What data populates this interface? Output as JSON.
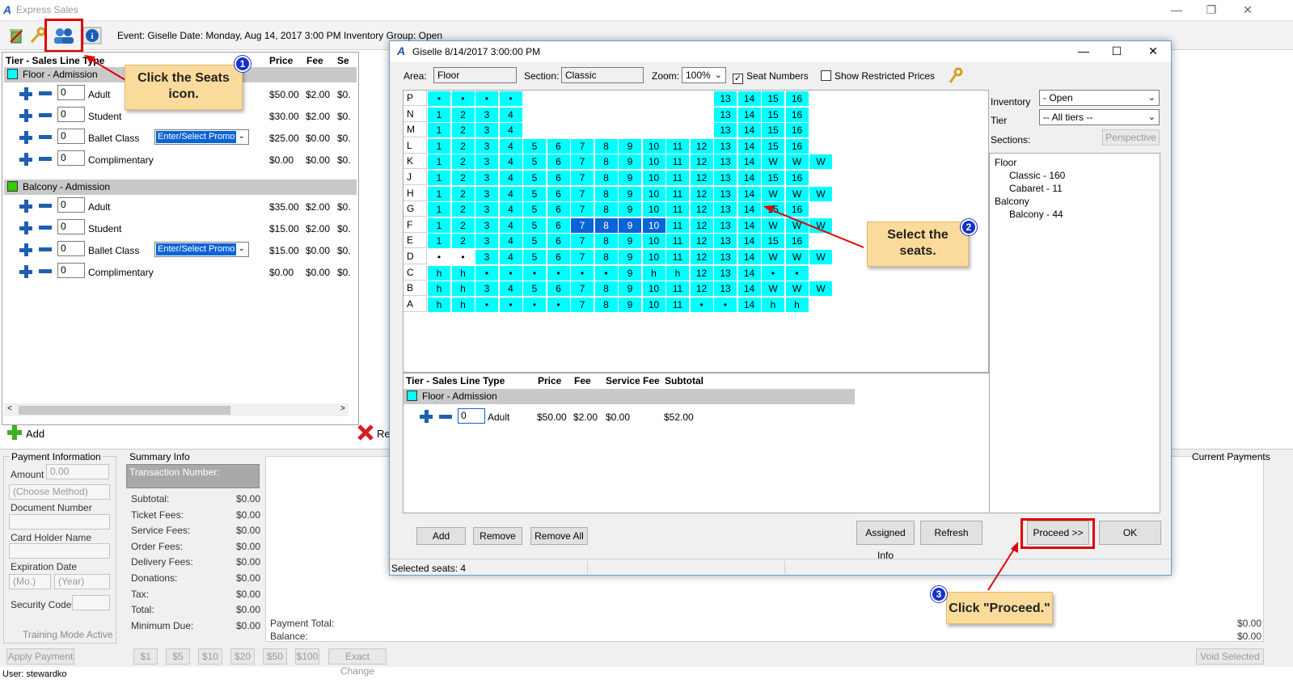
{
  "app": {
    "title": "Express Sales",
    "event_text": "Event:   Giselle Date: Monday, Aug 14, 2017 3:00 PM Inventory Group: Open"
  },
  "window_controls": {
    "minimize": "—",
    "restore": "❐",
    "close": "✕"
  },
  "left": {
    "headers": {
      "tier": "Tier - Sales Line Type",
      "price": "Price",
      "fee": "Fee",
      "se": "Se"
    },
    "groups": [
      {
        "name": "Floor - Admission",
        "color": "#00ffff",
        "lines": [
          {
            "qty": "0",
            "type": "Adult",
            "price": "$50.00",
            "fee": "$2.00",
            "se": "$0.",
            "promo": ""
          },
          {
            "qty": "0",
            "type": "Student",
            "price": "$30.00",
            "fee": "$2.00",
            "se": "$0.",
            "promo": ""
          },
          {
            "qty": "0",
            "type": "Ballet Class",
            "price": "$25.00",
            "fee": "$0.00",
            "se": "$0.",
            "promo": "Enter/Select Promo"
          },
          {
            "qty": "0",
            "type": "Complimentary",
            "price": "$0.00",
            "fee": "$0.00",
            "se": "$0.",
            "promo": ""
          }
        ]
      },
      {
        "name": "Balcony - Admission",
        "color": "#33cc00",
        "lines": [
          {
            "qty": "0",
            "type": "Adult",
            "price": "$35.00",
            "fee": "$2.00",
            "se": "$0.",
            "promo": ""
          },
          {
            "qty": "0",
            "type": "Student",
            "price": "$15.00",
            "fee": "$2.00",
            "se": "$0.",
            "promo": ""
          },
          {
            "qty": "0",
            "type": "Ballet Class",
            "price": "$15.00",
            "fee": "$0.00",
            "se": "$0.",
            "promo": "Enter/Select Promo"
          },
          {
            "qty": "0",
            "type": "Complimentary",
            "price": "$0.00",
            "fee": "$0.00",
            "se": "$0.",
            "promo": ""
          }
        ]
      }
    ],
    "add_label": "Add",
    "remove_label": "Re"
  },
  "payment": {
    "title": "Payment Information",
    "amount_label": "Amount",
    "amount_value": "0.00",
    "method": "(Choose Method)",
    "doc_label": "Document Number",
    "holder_label": "Card Holder Name",
    "exp_label": "Expiration Date",
    "month": "(Mo.)",
    "year": "(Year)",
    "sec_label": "Security Code",
    "training": "Training Mode Active",
    "apply": "Apply Payment"
  },
  "summary": {
    "title": "Summary Info",
    "txn": "Transaction Number:",
    "rows": [
      {
        "label": "Subtotal:",
        "value": "$0.00"
      },
      {
        "label": "Ticket Fees:",
        "value": "$0.00"
      },
      {
        "label": "Service Fees:",
        "value": "$0.00"
      },
      {
        "label": "Order Fees:",
        "value": "$0.00"
      },
      {
        "label": "Delivery Fees:",
        "value": "$0.00"
      },
      {
        "label": "Donations:",
        "value": "$0.00"
      },
      {
        "label": "Tax:",
        "value": "$0.00"
      },
      {
        "label": "Total:",
        "value": "$0.00"
      },
      {
        "label": "Minimum Due:",
        "value": "$0.00"
      }
    ]
  },
  "quick_cash": [
    "$1",
    "$5",
    "$10",
    "$20",
    "$50",
    "$100",
    "Exact Change"
  ],
  "payments": {
    "current": "Current Payments",
    "total_label": "Payment Total:",
    "balance_label": "Balance:",
    "total": "$0.00",
    "balance": "$0.00",
    "void": "Void Selected"
  },
  "status_user": "User: stewardko",
  "dialog": {
    "title": "Giselle 8/14/2017 3:00:00 PM",
    "area_label": "Area:",
    "area": "Floor",
    "section_label": "Section:",
    "section": "Classic",
    "zoom_label": "Zoom:",
    "zoom": "100%",
    "seat_numbers": "Seat Numbers",
    "seat_numbers_check": "✓",
    "restricted": "Show Restricted Prices",
    "inventory_label": "Inventory",
    "inventory": "- Open",
    "tier_label": "Tier",
    "tier": "-- All tiers --",
    "sections_label": "Sections:",
    "perspective": "Perspective",
    "tree": {
      "floor": "Floor",
      "classic": "Classic - 160",
      "cabaret": "Cabaret - 11",
      "balcony": "Balcony",
      "balcony44": "Balcony - 44"
    },
    "rows": [
      {
        "label": "P",
        "seats": [
          [
            "•",
            0
          ],
          [
            "•",
            1
          ],
          [
            "•",
            2
          ],
          [
            "•",
            3
          ],
          [
            "13",
            12
          ],
          [
            "14",
            13
          ],
          [
            "15",
            14
          ],
          [
            "16",
            15
          ]
        ]
      },
      {
        "label": "N",
        "seats": [
          [
            "1",
            0
          ],
          [
            "2",
            1
          ],
          [
            "3",
            2
          ],
          [
            "4",
            3
          ],
          [
            "13",
            12
          ],
          [
            "14",
            13
          ],
          [
            "15",
            14
          ],
          [
            "16",
            15
          ]
        ]
      },
      {
        "label": "M",
        "seats": [
          [
            "1",
            0
          ],
          [
            "2",
            1
          ],
          [
            "3",
            2
          ],
          [
            "4",
            3
          ],
          [
            "13",
            12
          ],
          [
            "14",
            13
          ],
          [
            "15",
            14
          ],
          [
            "16",
            15
          ]
        ]
      },
      {
        "label": "L",
        "seats": [
          [
            "1",
            0
          ],
          [
            "2",
            1
          ],
          [
            "3",
            2
          ],
          [
            "4",
            3
          ],
          [
            "5",
            4
          ],
          [
            "6",
            5
          ],
          [
            "7",
            6
          ],
          [
            "8",
            7
          ],
          [
            "9",
            8
          ],
          [
            "10",
            9
          ],
          [
            "11",
            10
          ],
          [
            "12",
            11
          ],
          [
            "13",
            12
          ],
          [
            "14",
            13
          ],
          [
            "15",
            14
          ],
          [
            "16",
            15
          ]
        ]
      },
      {
        "label": "K",
        "seats": [
          [
            "1",
            0
          ],
          [
            "2",
            1
          ],
          [
            "3",
            2
          ],
          [
            "4",
            3
          ],
          [
            "5",
            4
          ],
          [
            "6",
            5
          ],
          [
            "7",
            6
          ],
          [
            "8",
            7
          ],
          [
            "9",
            8
          ],
          [
            "10",
            9
          ],
          [
            "11",
            10
          ],
          [
            "12",
            11
          ],
          [
            "13",
            12
          ],
          [
            "14",
            13
          ],
          [
            "W",
            14
          ],
          [
            "W",
            15
          ],
          [
            "W",
            16
          ]
        ]
      },
      {
        "label": "J",
        "seats": [
          [
            "1",
            0
          ],
          [
            "2",
            1
          ],
          [
            "3",
            2
          ],
          [
            "4",
            3
          ],
          [
            "5",
            4
          ],
          [
            "6",
            5
          ],
          [
            "7",
            6
          ],
          [
            "8",
            7
          ],
          [
            "9",
            8
          ],
          [
            "10",
            9
          ],
          [
            "11",
            10
          ],
          [
            "12",
            11
          ],
          [
            "13",
            12
          ],
          [
            "14",
            13
          ],
          [
            "15",
            14
          ],
          [
            "16",
            15
          ]
        ]
      },
      {
        "label": "H",
        "seats": [
          [
            "1",
            0
          ],
          [
            "2",
            1
          ],
          [
            "3",
            2
          ],
          [
            "4",
            3
          ],
          [
            "5",
            4
          ],
          [
            "6",
            5
          ],
          [
            "7",
            6
          ],
          [
            "8",
            7
          ],
          [
            "9",
            8
          ],
          [
            "10",
            9
          ],
          [
            "11",
            10
          ],
          [
            "12",
            11
          ],
          [
            "13",
            12
          ],
          [
            "14",
            13
          ],
          [
            "W",
            14
          ],
          [
            "W",
            15
          ],
          [
            "W",
            16
          ]
        ]
      },
      {
        "label": "G",
        "seats": [
          [
            "1",
            0
          ],
          [
            "2",
            1
          ],
          [
            "3",
            2
          ],
          [
            "4",
            3
          ],
          [
            "5",
            4
          ],
          [
            "6",
            5
          ],
          [
            "7",
            6
          ],
          [
            "8",
            7
          ],
          [
            "9",
            8
          ],
          [
            "10",
            9
          ],
          [
            "11",
            10
          ],
          [
            "12",
            11
          ],
          [
            "13",
            12
          ],
          [
            "14",
            13
          ],
          [
            "15",
            14
          ],
          [
            "16",
            15
          ]
        ]
      },
      {
        "label": "F",
        "seats": [
          [
            "1",
            0
          ],
          [
            "2",
            1
          ],
          [
            "3",
            2
          ],
          [
            "4",
            3
          ],
          [
            "5",
            4
          ],
          [
            "6",
            5
          ],
          [
            "7",
            6,
            1
          ],
          [
            "8",
            7,
            1
          ],
          [
            "9",
            8,
            1
          ],
          [
            "10",
            9,
            1
          ],
          [
            "11",
            10
          ],
          [
            "12",
            11
          ],
          [
            "13",
            12
          ],
          [
            "14",
            13
          ],
          [
            "W",
            14
          ],
          [
            "W",
            15
          ],
          [
            "W",
            16
          ]
        ]
      },
      {
        "label": "E",
        "seats": [
          [
            "1",
            0
          ],
          [
            "2",
            1
          ],
          [
            "3",
            2
          ],
          [
            "4",
            3
          ],
          [
            "5",
            4
          ],
          [
            "6",
            5
          ],
          [
            "7",
            6
          ],
          [
            "8",
            7
          ],
          [
            "9",
            8
          ],
          [
            "10",
            9
          ],
          [
            "11",
            10
          ],
          [
            "12",
            11
          ],
          [
            "13",
            12
          ],
          [
            "14",
            13
          ],
          [
            "15",
            14
          ],
          [
            "16",
            15
          ]
        ]
      },
      {
        "label": "D",
        "seats": [
          [
            "•",
            0,
            2
          ],
          [
            "•",
            1,
            2
          ],
          [
            "3",
            2
          ],
          [
            "4",
            3
          ],
          [
            "5",
            4
          ],
          [
            "6",
            5
          ],
          [
            "7",
            6
          ],
          [
            "8",
            7
          ],
          [
            "9",
            8
          ],
          [
            "10",
            9
          ],
          [
            "11",
            10
          ],
          [
            "12",
            11
          ],
          [
            "13",
            12
          ],
          [
            "14",
            13
          ],
          [
            "W",
            14
          ],
          [
            "W",
            15
          ],
          [
            "W",
            16
          ]
        ]
      },
      {
        "label": "C",
        "seats": [
          [
            "h",
            0
          ],
          [
            "h",
            1
          ],
          [
            "•",
            2
          ],
          [
            "•",
            3
          ],
          [
            "•",
            4
          ],
          [
            "•",
            5
          ],
          [
            "•",
            6
          ],
          [
            "•",
            7
          ],
          [
            "9",
            8
          ],
          [
            "h",
            9
          ],
          [
            "h",
            10
          ],
          [
            "12",
            11
          ],
          [
            "13",
            12
          ],
          [
            "14",
            13
          ],
          [
            "•",
            14
          ],
          [
            "•",
            15
          ]
        ]
      },
      {
        "label": "B",
        "seats": [
          [
            "h",
            0
          ],
          [
            "h",
            1
          ],
          [
            "3",
            2
          ],
          [
            "4",
            3
          ],
          [
            "5",
            4
          ],
          [
            "6",
            5
          ],
          [
            "7",
            6
          ],
          [
            "8",
            7
          ],
          [
            "9",
            8
          ],
          [
            "10",
            9
          ],
          [
            "11",
            10
          ],
          [
            "12",
            11
          ],
          [
            "13",
            12
          ],
          [
            "14",
            13
          ],
          [
            "W",
            14
          ],
          [
            "W",
            15
          ],
          [
            "W",
            16
          ]
        ]
      },
      {
        "label": "A",
        "seats": [
          [
            "h",
            0
          ],
          [
            "h",
            1
          ],
          [
            "•",
            2
          ],
          [
            "•",
            3
          ],
          [
            "•",
            4
          ],
          [
            "•",
            5
          ],
          [
            "7",
            6
          ],
          [
            "8",
            7
          ],
          [
            "9",
            8
          ],
          [
            "10",
            9
          ],
          [
            "11",
            10
          ],
          [
            "•",
            11
          ],
          [
            "•",
            12
          ],
          [
            "14",
            13
          ],
          [
            "h",
            14
          ],
          [
            "h",
            15
          ]
        ]
      }
    ],
    "lines_header": {
      "tier": "Tier - Sales Line Type",
      "price": "Price",
      "fee": "Fee",
      "service": "Service Fee",
      "subtotal": "Subtotal"
    },
    "line_group": "Floor - Admission",
    "line": {
      "qty": "0",
      "type": "Adult",
      "price": "$50.00",
      "fee": "$2.00",
      "service": "$0.00",
      "subtotal": "$52.00"
    },
    "buttons": {
      "add": "Add",
      "remove": "Remove",
      "remove_all": "Remove All",
      "assigned": "Assigned Info",
      "refresh": "Refresh",
      "proceed": "Proceed  >>",
      "ok": "OK"
    },
    "status": "Selected seats:  4"
  },
  "callouts": {
    "c1": "Click the Seats icon.",
    "c2": "Select the seats.",
    "c3": "Click \"Proceed.\"",
    "b1": "1",
    "b2": "2",
    "b3": "3"
  }
}
